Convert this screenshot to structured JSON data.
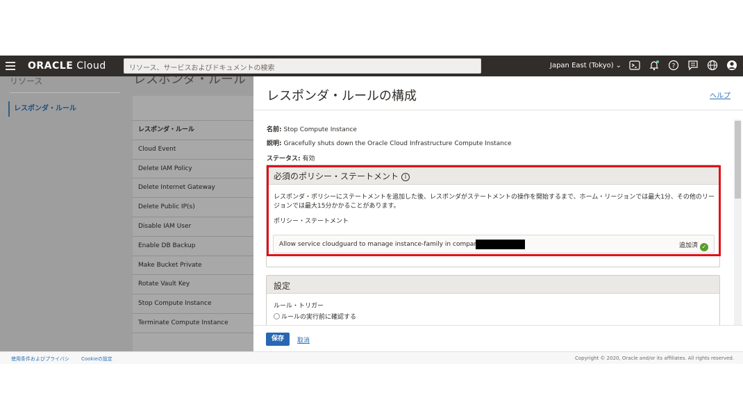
{
  "header": {
    "brand_bold": "ORACLE",
    "brand_light": " Cloud",
    "search_placeholder": "リソース、サービスおよびドキュメントの検索",
    "region": "Japan East (Tokyo)",
    "icons": [
      "menu-icon",
      "cloud-shell-icon",
      "bell-icon",
      "help-icon",
      "chat-icon",
      "globe-icon",
      "user-icon"
    ]
  },
  "background_page": {
    "left_title": "リソース",
    "left_item": "レスポンダ・ルール",
    "main_title": "レスポンダ・ルール",
    "table_header": "レスポンダ・ルール",
    "rows": [
      "Cloud Event",
      "Delete IAM Policy",
      "Delete Internet Gateway",
      "Delete Public IP(s)",
      "Disable IAM User",
      "Enable DB Backup",
      "Make Bucket Private",
      "Rotate Vault Key",
      "Stop Compute Instance",
      "Terminate Compute Instance"
    ]
  },
  "panel": {
    "title": "レスポンダ・ルールの構成",
    "help": "ヘルプ",
    "name_label": "名前:",
    "name_value": " Stop Compute Instance",
    "desc_label": "説明:",
    "desc_value": " Gracefully shuts down the Oracle Cloud Infrastructure Compute Instance",
    "status_label": "ステータス:",
    "status_value": " 有効",
    "policy": {
      "title": "必須のポリシー・ステートメント",
      "info_icon": "i",
      "description": "レスポンダ・ポリシーにステートメントを追加した後、レスポンダがステートメントの操作を開始するまで、ホーム・リージョンでは最大1分、その他のリージョンでは最大15分かかることがあります。",
      "subheading": "ポリシー・ステートメント",
      "statement": "Allow service cloudguard to manage instance-family in compartment",
      "added": "追加済",
      "check": "✓"
    },
    "settings": {
      "title": "設定",
      "trigger_label": "ルール・トリガー",
      "trigger_option": "ルールの実行前に確認する"
    },
    "save": "保存",
    "cancel": "取消"
  },
  "footer": {
    "terms": "使用条件およびプライバシ",
    "cookies": "Cookieの設定",
    "copyright": "Copyright © 2020, Oracle and/or its affiliates. All rights reserved."
  },
  "colors": {
    "nav_bg": "#312d2a",
    "accent": "#2867b1",
    "highlight": "#e0101a",
    "success": "#5a9c2e"
  }
}
